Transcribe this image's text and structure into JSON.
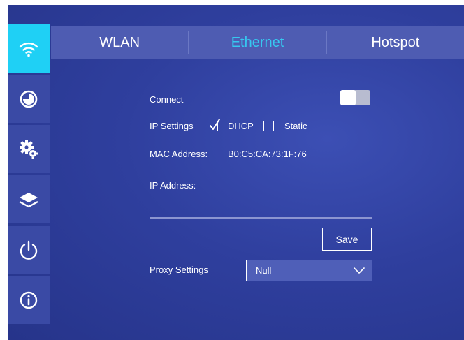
{
  "sidebar": {
    "items": [
      {
        "icon": "wifi-icon",
        "active": true
      },
      {
        "icon": "pie-chart-icon",
        "active": false
      },
      {
        "icon": "settings-gear-icon",
        "active": false
      },
      {
        "icon": "layers-icon",
        "active": false
      },
      {
        "icon": "power-icon",
        "active": false
      },
      {
        "icon": "info-icon",
        "active": false
      }
    ]
  },
  "tabs": [
    {
      "label": "WLAN",
      "active": false
    },
    {
      "label": "Ethernet",
      "active": true
    },
    {
      "label": "Hotspot",
      "active": false
    }
  ],
  "connect": {
    "label": "Connect",
    "enabled": false
  },
  "ip_settings": {
    "label": "IP Settings",
    "dhcp": {
      "label": "DHCP",
      "checked": true
    },
    "static": {
      "label": "Static",
      "checked": false
    }
  },
  "mac": {
    "label": "MAC Address:",
    "value": "B0:C5:CA:73:1F:76"
  },
  "ip_address": {
    "label": "IP Address:",
    "value": ""
  },
  "save_label": "Save",
  "proxy": {
    "label": "Proxy Settings",
    "selected": "Null"
  },
  "colors": {
    "background": "#2f3f9e",
    "accent_active": "#1fd0f5",
    "tab_bar": "#4e5cb2",
    "active_tab_text": "#36c8f0"
  }
}
